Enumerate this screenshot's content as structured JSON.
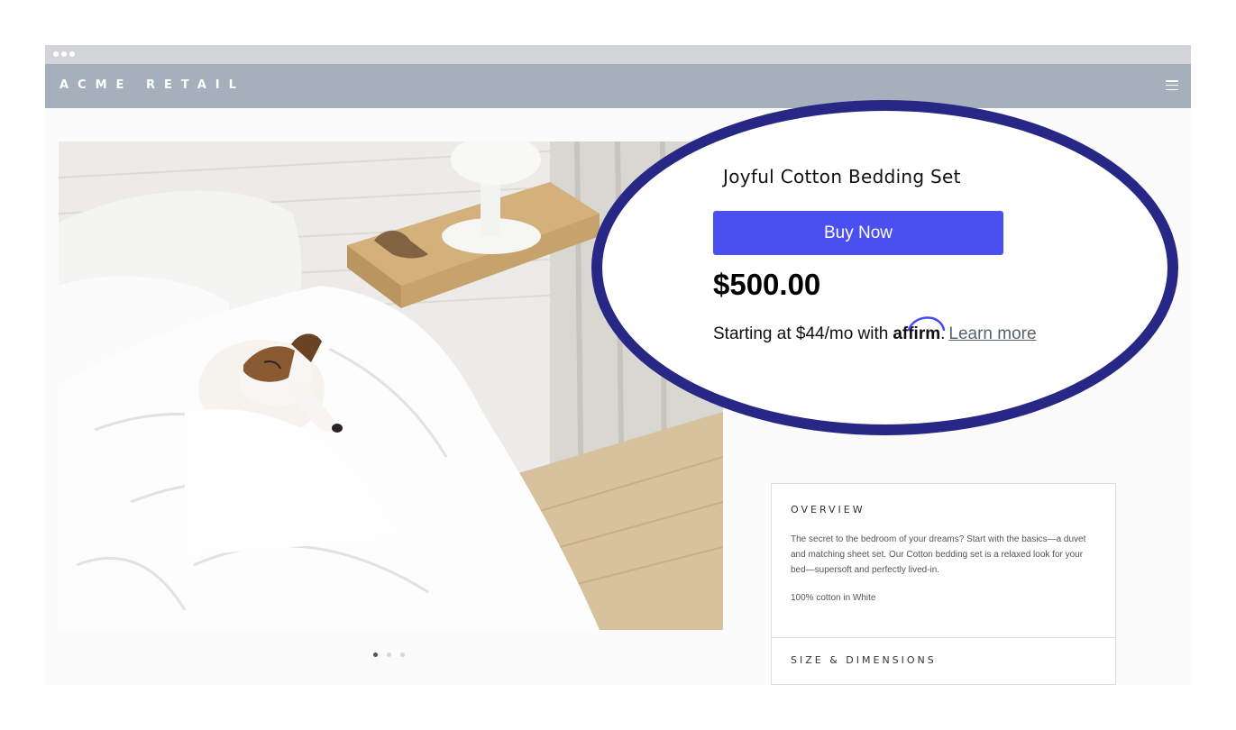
{
  "header": {
    "brand": "ACME RETAIL",
    "menu_icon": "hamburger-menu-icon"
  },
  "product": {
    "title": "Joyful Cotton Bedding Set",
    "buy_label": "Buy Now",
    "price": "$500.00",
    "financing_prefix": "Starting at $44/mo with",
    "financing_brand": "affirm",
    "financing_suffix": ".",
    "learn_more": "Learn more"
  },
  "carousel": {
    "count": 3,
    "active": 0
  },
  "overview": {
    "title": "OVERVIEW",
    "description": "The secret to the bedroom of your dreams? Start with the basics—a duvet and matching sheet set. Our Cotton bedding set is a relaxed look for your bed—supersoft and perfectly lived-in.",
    "material": "100% cotton in White"
  },
  "size_dimensions": {
    "title": "SIZE & DIMENSIONS"
  },
  "colors": {
    "header_bg": "#a6b0bd",
    "buy_button": "#4a4ff0",
    "callout_ring": "#272786",
    "affirm_accent": "#4a4af4"
  }
}
